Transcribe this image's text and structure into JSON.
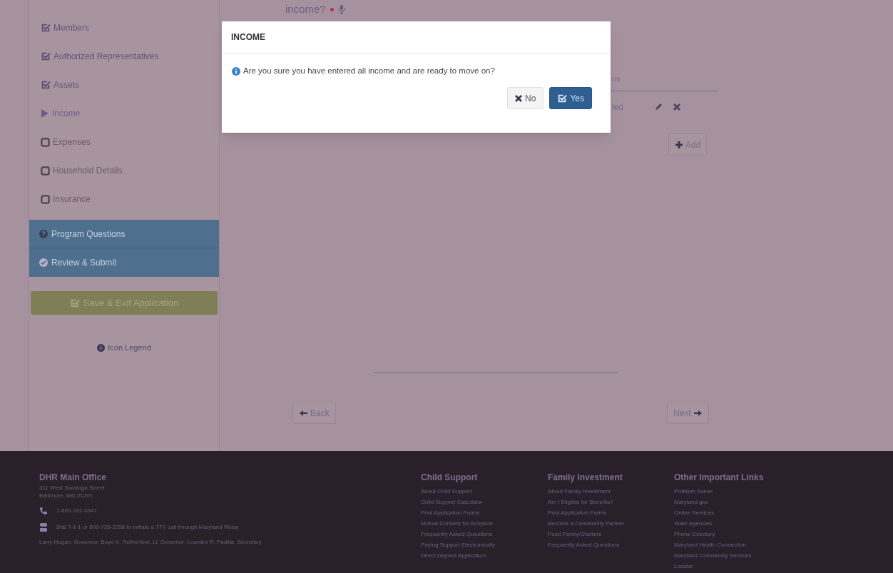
{
  "question": {
    "text": "income?",
    "required": true
  },
  "sidebar": {
    "steps": [
      {
        "label": "Members",
        "completed": true,
        "selected": false
      },
      {
        "label": "Authorized Representatives",
        "completed": true,
        "selected": false
      },
      {
        "label": "Assets",
        "completed": true,
        "selected": false
      },
      {
        "label": "Income",
        "completed": false,
        "selected": true
      },
      {
        "label": "Expenses",
        "completed": false,
        "selected": false
      },
      {
        "label": "Household Details",
        "completed": false,
        "selected": false
      },
      {
        "label": "Insurance",
        "completed": false,
        "selected": false
      }
    ],
    "actions": [
      {
        "label": "Program Questions",
        "kind": "question"
      },
      {
        "label": "Review & Submit",
        "kind": "check"
      }
    ],
    "save_button": "Save & Exit Application",
    "legend": "Icon Legend"
  },
  "table": {
    "column_fragment": "us",
    "cell_fragment": "led"
  },
  "add_button": "Add",
  "back_button": "Back",
  "next_button": "Next",
  "modal": {
    "title": "INCOME",
    "message": "Are you sure you have entered all income and are ready to move on?",
    "buttons": [
      {
        "label": "No",
        "kind": "cancel"
      },
      {
        "label": "Yes",
        "kind": "confirm"
      }
    ]
  },
  "footer": {
    "office": {
      "title": "DHR Main Office",
      "address": [
        "311 West Saratoga Street",
        "Baltimore, MD 21201"
      ],
      "phone": "1-800-332-6347",
      "tty": "Dial 7-1-1 or 800-735-2258 to initiate a TTY call through Maryland Relay",
      "officials": "Larry Hogan, Governor; Boyd K. Rutherford, Lt. Governor; Lourdes R. Padilla, Secretary"
    },
    "columns": [
      {
        "title": "Child Support",
        "links": [
          "About Child Support",
          "Child Support Calculator",
          "Print Application Forms",
          "Mutual Consent for Adoption",
          "Frequently Asked Questions",
          "Paying Support Electronically",
          "Direct Deposit Application"
        ]
      },
      {
        "title": "Family Investment",
        "links": [
          "About Family Investment",
          "Am I Eligible for Benefits?",
          "Print Application Forms",
          "Become a Community Partner",
          "Food Pantry/Shelters",
          "Frequently Asked Questions"
        ]
      },
      {
        "title": "Other Important Links",
        "links": [
          "Problem Solver",
          "Maryland.gov",
          "Online Services",
          "State Agencies",
          "Phone Directory",
          "Maryland Health Connection",
          "Maryland Community Services",
          "Locator"
        ]
      }
    ]
  }
}
